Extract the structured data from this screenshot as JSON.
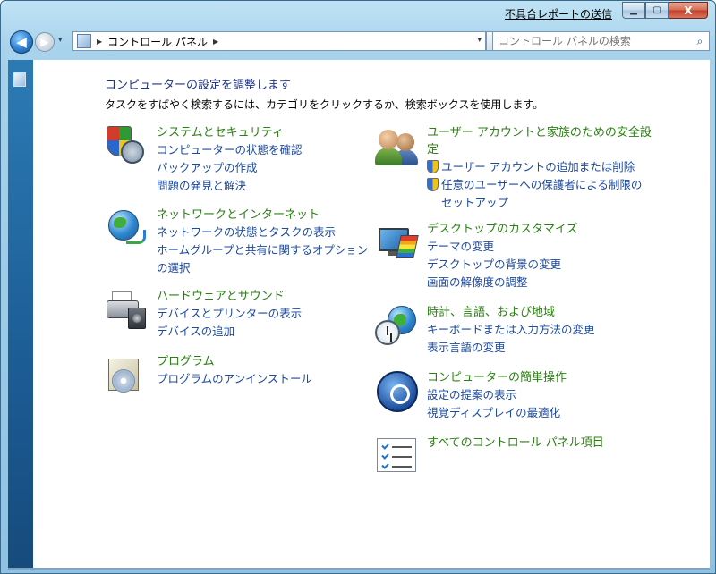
{
  "titlebar": {
    "feedback_link": "不具合レポートの送信",
    "minimize_glyph": "▁",
    "maximize_glyph": "▢",
    "close_glyph": "X"
  },
  "navigation": {
    "back_glyph": "◀",
    "forward_glyph": "▶",
    "recent_glyph": "▾",
    "breadcrumb_arrow": "▶",
    "breadcrumb_label": "コントロール パネル",
    "breadcrumb_arrow_after": "▶",
    "address_dropdown_glyph": "▾",
    "refresh_glyph": "↻",
    "search_placeholder": "コントロール パネルの検索",
    "search_glyph": "⌕"
  },
  "main": {
    "heading": "コンピューターの設定を調整します",
    "subheading": "タスクをすばやく検索するには、カテゴリをクリックするか、検索ボックスを使用します。"
  },
  "categories": {
    "system": {
      "title": "システムとセキュリティ",
      "links": [
        "コンピューターの状態を確認",
        "バックアップの作成",
        "問題の発見と解決"
      ]
    },
    "network": {
      "title": "ネットワークとインターネット",
      "links": [
        "ネットワークの状態とタスクの表示",
        "ホームグループと共有に関するオプション",
        "の選択"
      ]
    },
    "hardware": {
      "title": "ハードウェアとサウンド",
      "links": [
        "デバイスとプリンターの表示",
        "デバイスの追加"
      ]
    },
    "programs": {
      "title": "プログラム",
      "links": [
        "プログラムのアンインストール"
      ]
    },
    "accounts": {
      "title_line1": "ユーザー アカウントと家族のための安全設",
      "title_line2": "定",
      "links": [
        "ユーザー アカウントの追加または削除",
        "任意のユーザーへの保護者による制限の",
        "セットアップ"
      ]
    },
    "appearance": {
      "title": "デスクトップのカスタマイズ",
      "links": [
        "テーマの変更",
        "デスクトップの背景の変更",
        "画面の解像度の調整"
      ]
    },
    "clock": {
      "title": "時計、言語、および地域",
      "links": [
        "キーボードまたは入力方法の変更",
        "表示言語の変更"
      ]
    },
    "ease": {
      "title": "コンピューターの簡単操作",
      "links": [
        "設定の提案の表示",
        "視覚ディスプレイの最適化"
      ]
    },
    "all_items": {
      "title": "すべてのコントロール パネル項目"
    }
  },
  "colors": {
    "category_title": "#2a8012",
    "link": "#1c4aa0",
    "heading": "#1e3287"
  },
  "icons": {
    "system": "shield-gauge-icon",
    "network": "globe-network-icon",
    "hardware": "printer-speaker-icon",
    "programs": "program-box-icon",
    "accounts": "users-icon",
    "appearance": "monitor-palette-icon",
    "clock": "globe-clock-icon",
    "ease": "ease-of-access-icon",
    "all_items": "checklist-icon"
  }
}
